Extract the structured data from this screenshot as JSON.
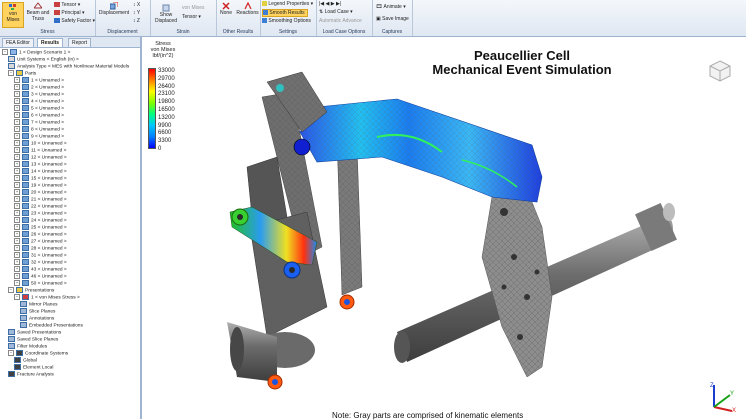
{
  "ribbon": {
    "groups": [
      {
        "label": "Stress",
        "buttons": [
          "von Mises",
          "Beam and Truss",
          "Tensor",
          "Principal",
          "Safety Factor"
        ]
      },
      {
        "label": "Displacement",
        "buttons": [
          "Displacement",
          "X",
          "Y",
          "Z"
        ]
      },
      {
        "label": "Strain",
        "buttons": [
          "Show Displaced",
          "von Mises",
          "Tensor"
        ]
      },
      {
        "label": "Other Results",
        "buttons": [
          "None",
          "Reactions"
        ]
      },
      {
        "label": "Settings",
        "buttons": [
          "Legend Properties",
          "Smooth Results",
          "Smoothing Options"
        ]
      },
      {
        "label": "Load Case Options",
        "buttons": [
          "Load Case",
          "Automatic Advance"
        ]
      },
      {
        "label": "Captures",
        "buttons": [
          "Animate",
          "Save Image"
        ]
      }
    ]
  },
  "tabs": [
    "FEA Editor",
    "Results",
    "Report"
  ],
  "tree": {
    "design_scenario": "1 < Design Scenario 1 >",
    "unit_systems": "Unit Systems < English (in) >",
    "analysis_type": "Analysis Type < MES with Nonlinear Material Models",
    "parts": "Parts",
    "part_items": [
      "1 < Unnamed >",
      "2 < Unnamed >",
      "3 < Unnamed >",
      "4 < Unnamed >",
      "5 < Unnamed >",
      "6 < Unnamed >",
      "7 < Unnamed >",
      "8 < Unnamed >",
      "9 < Unnamed >",
      "10 < Unnamed >",
      "11 < Unnamed >",
      "12 < Unnamed >",
      "13 < Unnamed >",
      "14 < Unnamed >",
      "15 < Unnamed >",
      "19 < Unnamed >",
      "20 < Unnamed >",
      "21 < Unnamed >",
      "22 < Unnamed >",
      "23 < Unnamed >",
      "24 < Unnamed >",
      "25 < Unnamed >",
      "26 < Unnamed >",
      "27 < Unnamed >",
      "28 < Unnamed >",
      "31 < Unnamed >",
      "32 < Unnamed >",
      "43 < Unnamed >",
      "46 < Unnamed >",
      "50 < Unnamed >"
    ],
    "presentations": "Presentations",
    "presentation_items": [
      "1 < von Mises Stress >",
      "Mirror Planes",
      "Slice Planes",
      "Annotations",
      "Embedded Presentations"
    ],
    "others": [
      "Saved Presentations",
      "Saved Slice Planes",
      "Filter Modules",
      "Coordinate Systems",
      "Global",
      "Element Local",
      "Fracture Analysis"
    ]
  },
  "view": {
    "title_line1": "Peaucellier Cell",
    "title_line2": "Mechanical Event Simulation",
    "legend_title": [
      "Stress",
      "von Mises",
      "lbf/(in^2)"
    ],
    "legend_values": [
      "33000",
      "29700",
      "26400",
      "23100",
      "19800",
      "16500",
      "13200",
      "9900",
      "6600",
      "3300",
      "0"
    ],
    "note": "Note:  Gray parts are comprised of kinematic elements"
  },
  "colors": {
    "ribbon_bg": "#dfe7f2",
    "selected": "#ffd35e",
    "mesh_gray": "#8a8a8a"
  }
}
